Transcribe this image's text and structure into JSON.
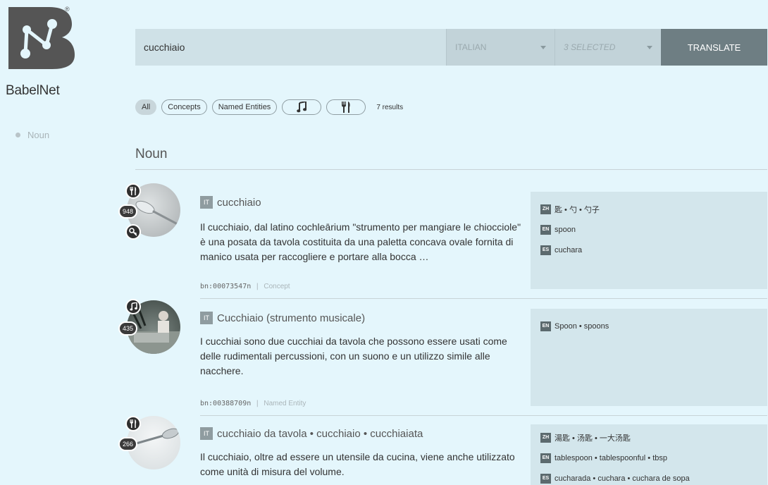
{
  "brand": {
    "name": "BabelNet"
  },
  "sidebar": {
    "items": [
      {
        "label": "Noun"
      }
    ]
  },
  "search": {
    "query": "cucchiaio",
    "source_lang": "ITALIAN",
    "targets": "3 SELECTED",
    "translate_label": "TRANSLATE"
  },
  "filters": {
    "all": "All",
    "concepts": "Concepts",
    "named_entities": "Named Entities",
    "music_icon": "music-note-icon",
    "food_icon": "fork-knife-icon",
    "results": "7 results"
  },
  "section": {
    "title": "Noun"
  },
  "results": [
    {
      "lang": "IT",
      "title": "cucchiaio",
      "gloss": "Il cucchiaio, dal latino cochleārium \"strumento per mangiare le chiocciole\" è una posata da tavola costituita da una paletta concava ovale fornita di manico usata per raccogliere e portare alla bocca …",
      "id": "bn:00073547n",
      "kind": "Concept",
      "count": "948",
      "domain_icons": [
        "fork-knife-icon",
        "key-icon"
      ],
      "translations": [
        {
          "lang": "ZH",
          "text": "匙 • 勺 • 勺子"
        },
        {
          "lang": "EN",
          "text": "spoon"
        },
        {
          "lang": "ES",
          "text": "cuchara"
        }
      ]
    },
    {
      "lang": "IT",
      "title": "Cucchiaio (strumento musicale)",
      "gloss": "I cucchiai sono due cucchiai da tavola che possono essere usati come delle rudimentali percussioni, con un suono e un utilizzo simile alle nacchere.",
      "id": "bn:00388709n",
      "kind": "Named Entity",
      "count": "435",
      "domain_icons": [
        "music-note-icon"
      ],
      "translations": [
        {
          "lang": "EN",
          "text": "Spoon • spoons"
        }
      ]
    },
    {
      "lang": "IT",
      "title": "cucchiaio da tavola • cucchiaio • cucchiaiata",
      "gloss": "Il cucchiaio, oltre ad essere un utensile da cucina, viene anche utilizzato come unità di misura del volume.",
      "id": "",
      "kind": "",
      "count": "266",
      "domain_icons": [
        "fork-knife-icon"
      ],
      "translations": [
        {
          "lang": "ZH",
          "text": "湯匙 • 汤匙 • 一大汤匙"
        },
        {
          "lang": "EN",
          "text": "tablespoon • tablespoonful • tbsp"
        },
        {
          "lang": "ES",
          "text": "cucharada • cuchara • cuchara de sopa"
        }
      ]
    }
  ],
  "colors": {
    "background": "#e4f6fc",
    "translate_button": "#6e7e83",
    "panel": "#d3e6ec",
    "tag": "#5c6a6e"
  }
}
